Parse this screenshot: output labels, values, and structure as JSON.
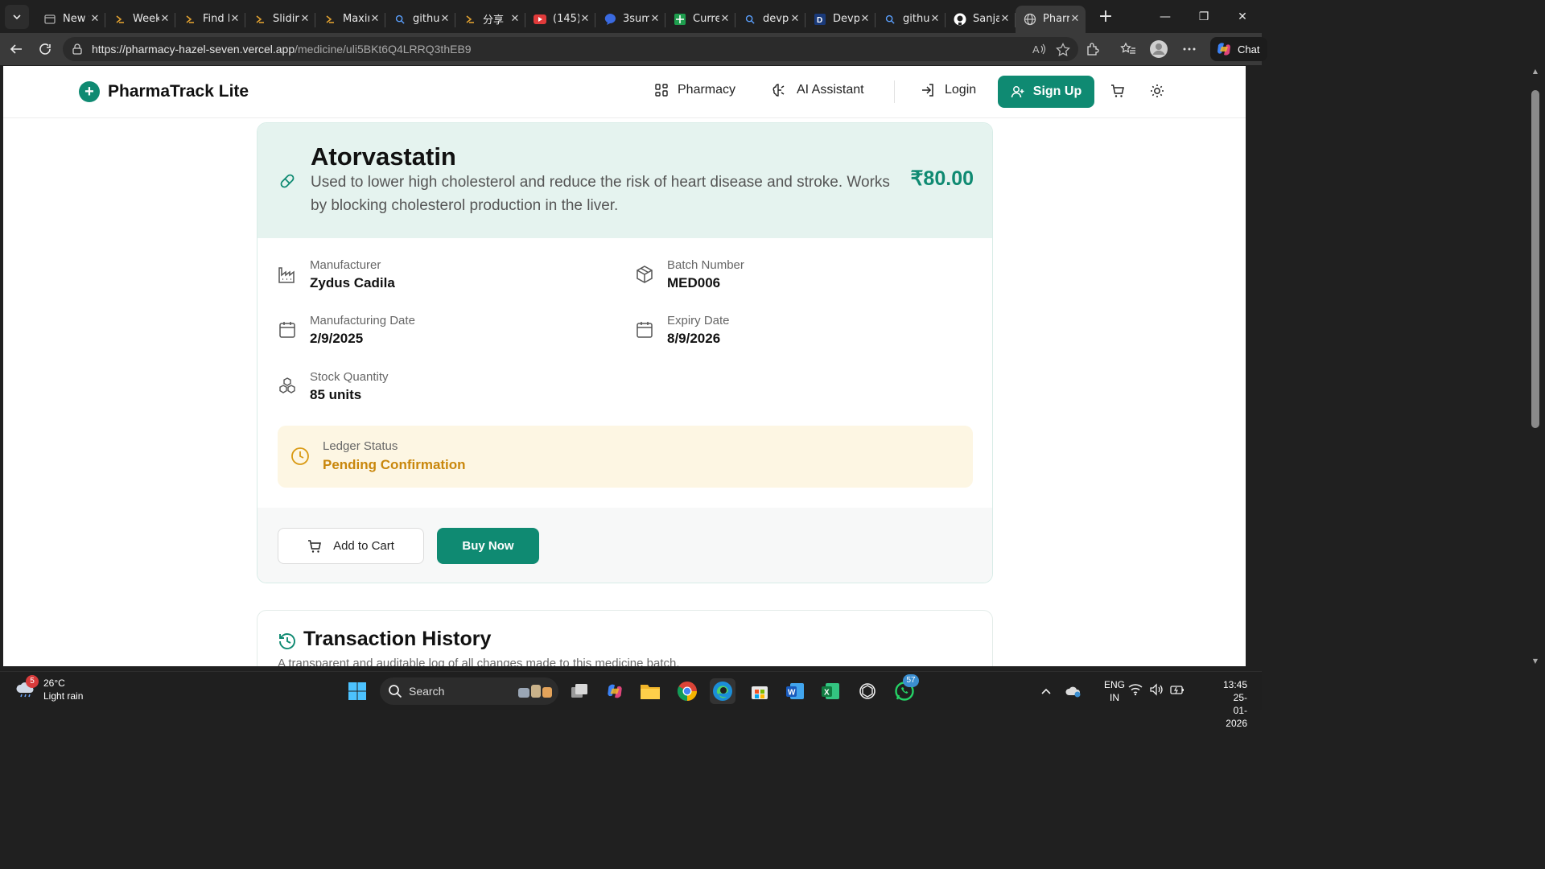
{
  "browser": {
    "tabs": [
      {
        "title": "New tab",
        "icon": "newtab-icon",
        "color": "#aaaaaa"
      },
      {
        "title": "Weekly",
        "icon": "arrow-icon",
        "color": "#e0a030"
      },
      {
        "title": "Find Ir",
        "icon": "arrow-icon",
        "color": "#e0a030"
      },
      {
        "title": "Sliding",
        "icon": "arrow-icon",
        "color": "#e0a030"
      },
      {
        "title": "Maxim",
        "icon": "arrow-icon",
        "color": "#e0a030"
      },
      {
        "title": "githu",
        "icon": "search-icon",
        "color": "#5aa0ff"
      },
      {
        "title": "分享",
        "icon": "arrow-icon",
        "color": "#e0a030"
      },
      {
        "title": "(145)",
        "icon": "youtube-icon",
        "color": "#e03a3a"
      },
      {
        "title": "3sum",
        "icon": "chat-icon",
        "color": "#3a6ae0"
      },
      {
        "title": "Curre",
        "icon": "sheet-icon",
        "color": "#1e9e4e"
      },
      {
        "title": "devp",
        "icon": "search-icon",
        "color": "#5aa0ff"
      },
      {
        "title": "Devp",
        "icon": "d-icon",
        "color": "#1a3a7a"
      },
      {
        "title": "githu",
        "icon": "search-icon",
        "color": "#5aa0ff"
      },
      {
        "title": "Sanja",
        "icon": "github-icon",
        "color": "#ffffff"
      },
      {
        "title": "Pharr",
        "icon": "globe-icon",
        "color": "#cccccc",
        "active": true
      }
    ],
    "url_host": "https://pharmacy-hazel-seven.vercel.app",
    "url_path": "/medicine/uli5BKt6Q4LRRQ3thEB9",
    "chat_label": "Chat"
  },
  "header": {
    "brand": "PharmaTrack Lite",
    "nav": {
      "pharmacy": "Pharmacy",
      "ai": "AI Assistant",
      "login": "Login",
      "signup": "Sign Up"
    }
  },
  "medicine": {
    "name": "Atorvastatin",
    "description": "Used to lower high cholesterol and reduce the risk of heart disease and stroke. Works by blocking cholesterol production in the liver.",
    "price": "₹80.00",
    "manufacturer_label": "Manufacturer",
    "manufacturer": "Zydus Cadila",
    "batch_label": "Batch Number",
    "batch": "MED006",
    "mfg_label": "Manufacturing Date",
    "mfg_date": "2/9/2025",
    "exp_label": "Expiry Date",
    "exp_date": "8/9/2026",
    "stock_label": "Stock Quantity",
    "stock": "85 units",
    "ledger_label": "Ledger Status",
    "ledger_status": "Pending Confirmation",
    "add_to_cart": "Add to Cart",
    "buy_now": "Buy Now"
  },
  "history": {
    "title": "Transaction History",
    "subtitle": "A transparent and auditable log of all changes made to this medicine batch."
  },
  "taskbar": {
    "temperature": "26°C",
    "weather": "Light rain",
    "weather_badge": "5",
    "search": "Search",
    "whatsapp_badge": "57",
    "lang1": "ENG",
    "lang2": "IN",
    "time": "13:45",
    "date": "25-01-2026"
  },
  "colors": {
    "accent": "#0f8a72",
    "pending": "#c9870c",
    "ledger_bg": "#fdf6e3",
    "card_top": "#e5f3ef"
  }
}
